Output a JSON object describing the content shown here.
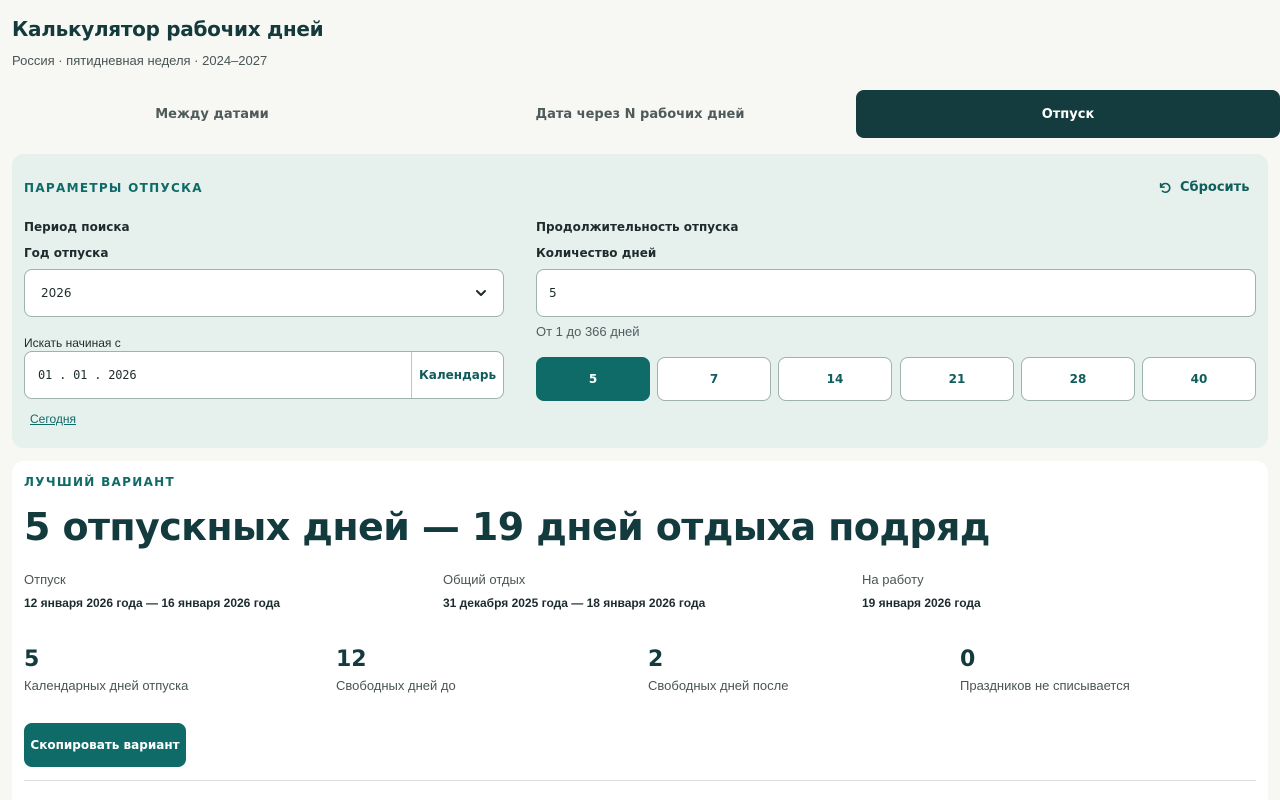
{
  "app": {
    "title": "Калькулятор рабочих дней",
    "subtitle": "Россия · пятидневная неделя · 2024–2027"
  },
  "tabs": [
    {
      "label": "Между датами",
      "active": false
    },
    {
      "label": "Дата через N рабочих дней",
      "active": false
    },
    {
      "label": "Отпуск",
      "active": true
    }
  ],
  "params": {
    "title": "ПАРАМЕТРЫ ОТПУСКА",
    "reset_label": "Сбросить",
    "search_period_label": "Период поиска",
    "year_label": "Год отпуска",
    "year_value": "2026",
    "start_label": "Искать начиная с",
    "start_value": "01 . 01 . 2026",
    "calendar_label": "Календарь",
    "today_label": "Сегодня",
    "duration_label": "Продолжительность отпуска",
    "days_label": "Количество дней",
    "days_value": "5",
    "days_hint": "От 1 до 366 дней",
    "presets": [
      "5",
      "7",
      "14",
      "21",
      "28",
      "40"
    ],
    "active_preset": "5"
  },
  "result": {
    "title": "ЛУЧШИЙ ВАРИАНТ",
    "headline": "5 отпускных дней — 19 дней отдыха подряд",
    "info": [
      {
        "label": "Отпуск",
        "value": "12 января 2026 года — 16 января 2026 года"
      },
      {
        "label": "Общий отдых",
        "value": "31 декабря 2025 года — 18 января 2026 года"
      },
      {
        "label": "На работу",
        "value": "19 января 2026 года"
      }
    ],
    "stats": [
      {
        "number": "5",
        "label": "Календарных дней отпуска"
      },
      {
        "number": "12",
        "label": "Свободных дней до"
      },
      {
        "number": "2",
        "label": "Свободных дней после"
      },
      {
        "number": "0",
        "label": "Праздников не списывается"
      }
    ],
    "copy_label": "Скопировать вариант"
  },
  "colors": {
    "accent": "#0f6b68",
    "dark": "#143c3e",
    "panel": "#e6f0ec"
  }
}
